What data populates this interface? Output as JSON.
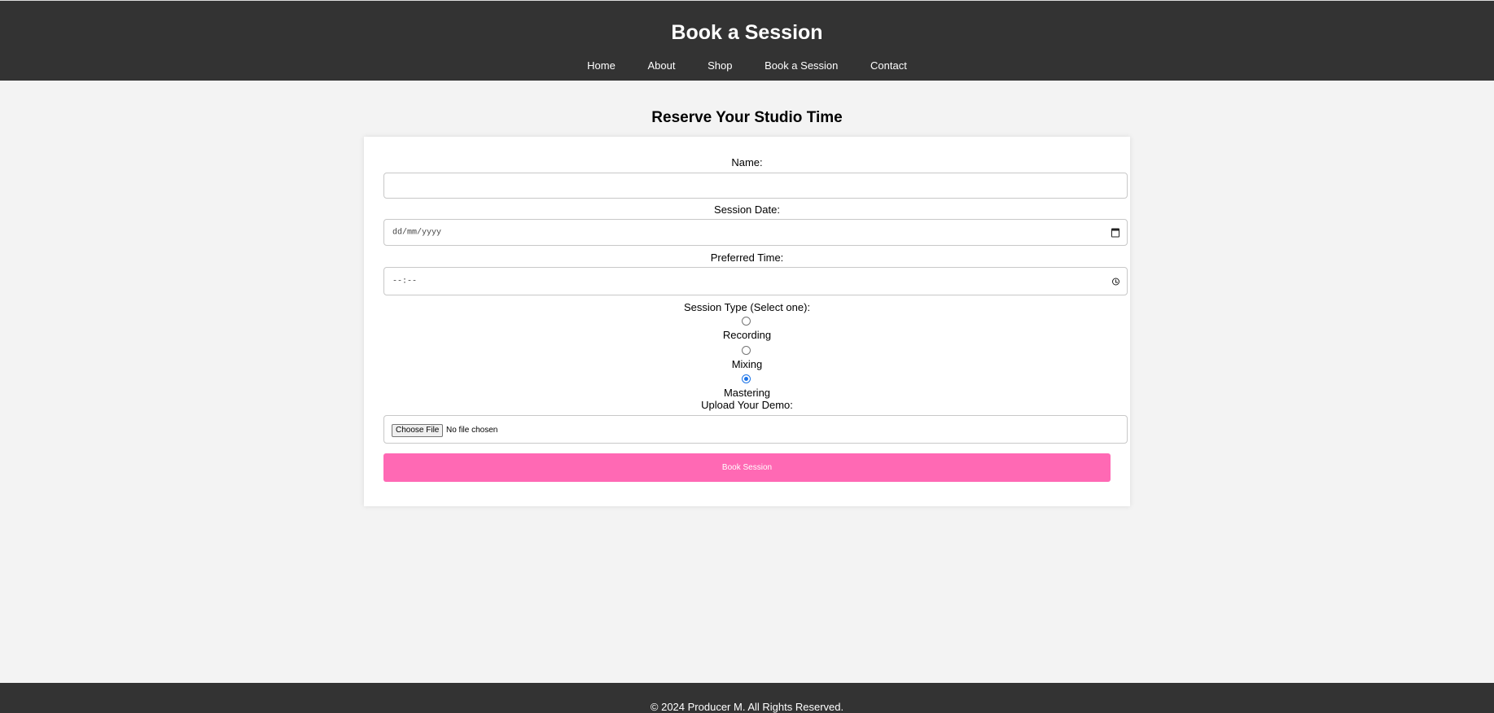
{
  "header": {
    "title": "Book a Session",
    "nav": [
      "Home",
      "About",
      "Shop",
      "Book a Session",
      "Contact"
    ]
  },
  "main": {
    "heading": "Reserve Your Studio Time"
  },
  "form": {
    "name_label": "Name:",
    "name_value": "",
    "date_label": "Session Date:",
    "date_placeholder": "dd/mm/yyyy",
    "time_label": "Preferred Time:",
    "time_placeholder": "--:--",
    "session_type_label": "Session Type (Select one):",
    "session_types": [
      "Recording",
      "Mixing",
      "Mastering"
    ],
    "session_type_selected": "Mastering",
    "upload_label": "Upload Your Demo:",
    "file_button": "Choose File",
    "file_status": "No file chosen",
    "submit_label": "Book Session"
  },
  "footer": {
    "text": "© 2024 Producer M. All Rights Reserved."
  },
  "colors": {
    "header_bg": "#333333",
    "page_bg": "#f3f3f3",
    "accent": "#ff69b4",
    "radio_checked": "#1a73e8"
  },
  "icons": {
    "date_field": "calendar-icon",
    "time_field": "clock-icon"
  }
}
